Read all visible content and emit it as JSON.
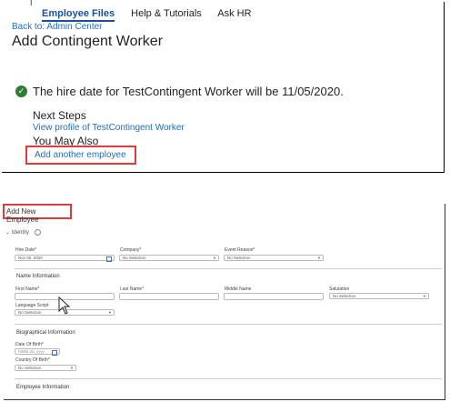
{
  "top_window": {
    "tabs": [
      "Employee Files",
      "Help & Tutorials",
      "Ask HR"
    ],
    "back_link": "Back to: Admin Center",
    "title": "Add Contingent Worker",
    "success_message": "The hire date for TestContingent Worker will be 11/05/2020.",
    "next_steps_heading": "Next Steps",
    "view_profile_link": "View profile of TestContingent Worker",
    "you_may_also_heading": "You May Also",
    "add_another_link": "Add another employee",
    "cursor_glyph": "I"
  },
  "form": {
    "title": "Add New Employee",
    "identity_label": "Identity",
    "hire_date_label": "Hire Date*",
    "hire_date_value": "Nov 05, 2020",
    "company_label": "Company*",
    "company_value": "No Selection",
    "event_reason_label": "Event Reason*",
    "event_reason_value": "No Selection",
    "name_section": "Name Information",
    "first_name_label": "First Name*",
    "last_name_label": "Last Name*",
    "middle_name_label": "Middle Name",
    "salutation_label": "Salutation",
    "salutation_value": "No Selection",
    "language_label": "Language Script",
    "language_value": "No Selection",
    "bio_section": "Biographical Information",
    "dob_label": "Date Of Birth*",
    "dob_placeholder": "MMM dd, yyyy",
    "country_label": "Country Of Birth*",
    "country_value": "No Selection",
    "employee_section": "Employee Information"
  },
  "colors": {
    "link": "#1f6fbf",
    "highlight": "#e23b3b",
    "success": "#2f7d32"
  },
  "icons": [
    "check-circle-icon",
    "calendar-icon",
    "chevron-down-icon",
    "info-icon",
    "mouse-pointer-icon",
    "text-cursor-icon"
  ]
}
